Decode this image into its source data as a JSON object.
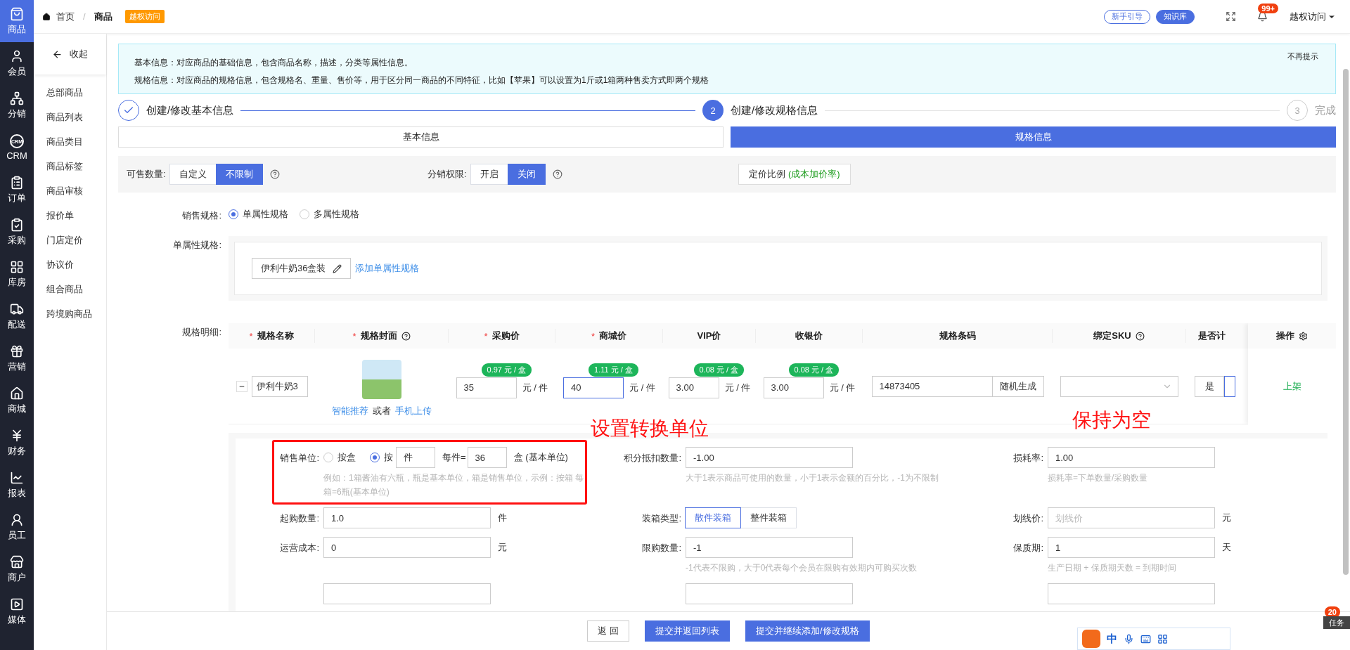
{
  "rail": {
    "items": [
      {
        "label": "商品",
        "selected": true
      },
      {
        "label": "会员",
        "selected": false
      },
      {
        "label": "分销",
        "selected": false
      },
      {
        "label": "CRM",
        "badge": "CRM",
        "selected": false
      },
      {
        "label": "订单",
        "selected": false
      },
      {
        "label": "采购",
        "selected": false
      },
      {
        "label": "库房",
        "selected": false
      },
      {
        "label": "配送",
        "selected": false
      },
      {
        "label": "营销",
        "selected": false
      },
      {
        "label": "商城",
        "selected": false
      },
      {
        "label": "财务",
        "selected": false
      },
      {
        "label": "报表",
        "selected": false
      },
      {
        "label": "员工",
        "selected": false
      },
      {
        "label": "商户",
        "selected": false
      },
      {
        "label": "媒体",
        "selected": false
      }
    ]
  },
  "subnav": {
    "collapse": "收起",
    "items": [
      "总部商品",
      "商品列表",
      "商品类目",
      "商品标签",
      "商品审核",
      "报价单",
      "门店定价",
      "协议价",
      "组合商品",
      "跨境购商品"
    ]
  },
  "topbar": {
    "breadcrumb": [
      "首页",
      "商品"
    ],
    "separator": "/",
    "tag": "越权访问",
    "guide": "新手引导",
    "knowledge": "知识库",
    "notifications": "99+",
    "user": "越权访问"
  },
  "notice": {
    "lines": [
      "基本信息：对应商品的基础信息，包含商品名称，描述，分类等属性信息。",
      "规格信息：对应商品的规格信息，包含规格名、重量、售价等，用于区分同一商品的不同特征，比如【苹果】可以设置为1斤或1箱两种售卖方式即两个规格"
    ],
    "dismiss": "不再提示"
  },
  "steps": [
    {
      "label": "创建/修改基本信息",
      "done": true,
      "active": false
    },
    {
      "number": "2",
      "label": "创建/修改规格信息",
      "done": false,
      "active": true
    },
    {
      "number": "3",
      "label": "完成",
      "done": false,
      "active": false
    }
  ],
  "tabs": [
    {
      "label": "基本信息",
      "selected": false
    },
    {
      "label": "规格信息",
      "selected": true
    }
  ],
  "settings": [
    {
      "label": "可售数量:",
      "options": [
        {
          "label": "自定义",
          "selected": false
        },
        {
          "label": "不限制",
          "selected": true
        }
      ],
      "help": true
    },
    {
      "label": "分销权限:",
      "options": [
        {
          "label": "开启",
          "selected": false
        },
        {
          "label": "关闭",
          "selected": true
        }
      ],
      "help": true
    }
  ],
  "pricing": {
    "label": "定价比例",
    "note": "(成本加价率)"
  },
  "sale_spec": {
    "label": "销售规格:",
    "options": [
      {
        "label": "单属性规格",
        "selected": true
      },
      {
        "label": "多属性规格",
        "selected": false
      }
    ]
  },
  "single_spec": {
    "label": "单属性规格:",
    "chips": [
      "伊利牛奶36盒装"
    ],
    "add_link": "添加单属性规格"
  },
  "spec_table": {
    "label": "规格明细:",
    "columns": [
      {
        "mark": "*",
        "label": "规格名称",
        "help": false
      },
      {
        "mark": "*",
        "label": "规格封面",
        "help": true
      },
      {
        "mark": "*",
        "label": "采购价",
        "help": false
      },
      {
        "mark": "*",
        "label": "商城价",
        "help": false
      },
      {
        "label": "VIP价",
        "help": false
      },
      {
        "label": "收银价",
        "help": false
      },
      {
        "label": "规格条码",
        "help": false
      },
      {
        "label": "绑定SKU",
        "help": true
      },
      {
        "label": "是否计",
        "help": false
      }
    ],
    "action_column": "操作",
    "rows": [
      {
        "name": "伊利牛奶3",
        "cover_links": [
          "智能推荐",
          "或者",
          "手机上传"
        ],
        "prices": [
          {
            "value": "35",
            "badge": "0.97 元 / 盒",
            "unit": "元 / 件",
            "focused": false
          },
          {
            "value": "40",
            "badge": "1.11 元 / 盒",
            "unit": "元 / 件",
            "focused": true
          },
          {
            "value": "3.00",
            "badge": "0.08 元 / 盒",
            "unit": "元 / 件",
            "focused": false
          },
          {
            "value": "3.00",
            "badge": "0.08 元 / 盒",
            "unit": "元 / 件",
            "focused": false
          }
        ],
        "barcode": "14873405",
        "generate": "随机生成",
        "weigh": "是",
        "action": "上架"
      }
    ]
  },
  "details": {
    "fields": [
      {
        "kind": "unit",
        "label": "销售单位:",
        "options": [
          {
            "label": "按盒",
            "selected": false
          },
          {
            "label": "按",
            "selected": true
          }
        ],
        "unit_value": "件",
        "per_label": "每件=",
        "count": "36",
        "base": "盒 (基本单位)",
        "hint": "例如：1箱酱油有六瓶，瓶是基本单位，箱是销售单位，示例：按箱 每箱=6瓶(基本单位)"
      },
      {
        "kind": "input",
        "label": "积分抵扣数量:",
        "value": "-1.00",
        "hint": "大于1表示商品可使用的数量，小于1表示金额的百分比，-1为不限制"
      },
      {
        "kind": "input",
        "label": "损耗率:",
        "value": "1.00",
        "hint": "损耗率=下单数量/采购数量"
      },
      {
        "kind": "input",
        "label": "起购数量:",
        "value": "1.0",
        "suffix": "件"
      },
      {
        "kind": "segmented",
        "label": "装箱类型:",
        "options": [
          {
            "label": "散件装箱",
            "selected": true
          },
          {
            "label": "整件装箱",
            "selected": false
          }
        ]
      },
      {
        "kind": "input",
        "label": "划线价:",
        "placeholder": "划线价",
        "suffix": "元"
      },
      {
        "kind": "input",
        "label": "运营成本:",
        "value": "0",
        "suffix": "元"
      },
      {
        "kind": "input",
        "label": "限购数量:",
        "value": "-1",
        "hint": "-1代表不限购，大于0代表每个会员在限购有效期内可购买次数"
      },
      {
        "kind": "input",
        "label": "保质期:",
        "value": "1",
        "suffix": "天",
        "hint": "生产日期 + 保质期天数 = 到期时间"
      }
    ]
  },
  "annotations": [
    {
      "text": "设置转换单位"
    },
    {
      "text": "保持为空"
    }
  ],
  "footer": {
    "buttons": [
      {
        "label": "返 回",
        "primary": false
      },
      {
        "label": "提交并返回列表",
        "primary": true
      },
      {
        "label": "提交并继续添加/修改规格",
        "primary": true
      }
    ]
  },
  "task_widget": {
    "count": "20",
    "label": "任务"
  },
  "ime": {
    "label": "中"
  }
}
